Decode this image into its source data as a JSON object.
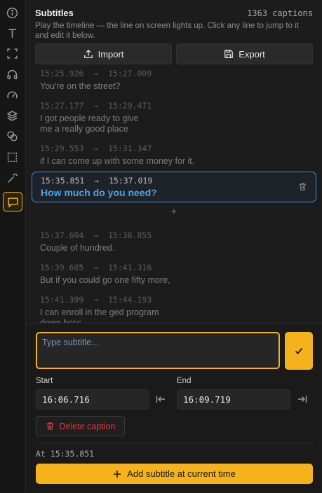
{
  "rail": {
    "items": [
      {
        "icon": "info-icon"
      },
      {
        "icon": "text-icon"
      },
      {
        "icon": "crop-icon"
      },
      {
        "icon": "headphones-icon"
      },
      {
        "icon": "speed-gauge-icon"
      },
      {
        "icon": "layers-icon"
      },
      {
        "icon": "circles-icon"
      },
      {
        "icon": "selection-icon"
      },
      {
        "icon": "magic-wand-icon"
      },
      {
        "icon": "subtitles-icon",
        "active": true
      }
    ]
  },
  "header": {
    "title": "Subtitles",
    "count": "1363 captions",
    "hint": "Play the timeline — the line on screen lights up. Click any line to jump to it and edit it below."
  },
  "toolbar": {
    "import_label": "Import",
    "export_label": "Export"
  },
  "cues": [
    {
      "start": "15:25.926",
      "end": "15:27.009",
      "text": "You're on the street?"
    },
    {
      "start": "15:27.177",
      "end": "15:29.471",
      "text": "I got people ready to give\nme a really good place"
    },
    {
      "start": "15:29.553",
      "end": "15:31.347",
      "text": "if I can come up with some money for it."
    },
    {
      "start": "15:35.851",
      "end": "15:37.019",
      "text": "How much do you need?",
      "selected": true
    },
    {
      "start": "15:37.604",
      "end": "15:38.855",
      "text": "Couple of hundred."
    },
    {
      "start": "15:39.605",
      "end": "15:41.316",
      "text": "But if you could go one fifty more,"
    },
    {
      "start": "15:41.399",
      "end": "15:44.193",
      "text": "I can enroll in the ged program\ndown bccc"
    }
  ],
  "arrow": "→",
  "insert_symbol": "+",
  "editor": {
    "placeholder": "Type subtitle...",
    "value": "",
    "start_label": "Start",
    "start_value": "16:06.716",
    "end_label": "End",
    "end_value": "16:09.719",
    "delete_label": "Delete caption",
    "at_time": "At 15:35.851",
    "add_label": "Add subtitle at current time"
  },
  "colors": {
    "accent": "#f5b21b",
    "selected_border": "#3d8fd6",
    "selected_text": "#4aa3e8",
    "danger": "#e03a3a"
  }
}
